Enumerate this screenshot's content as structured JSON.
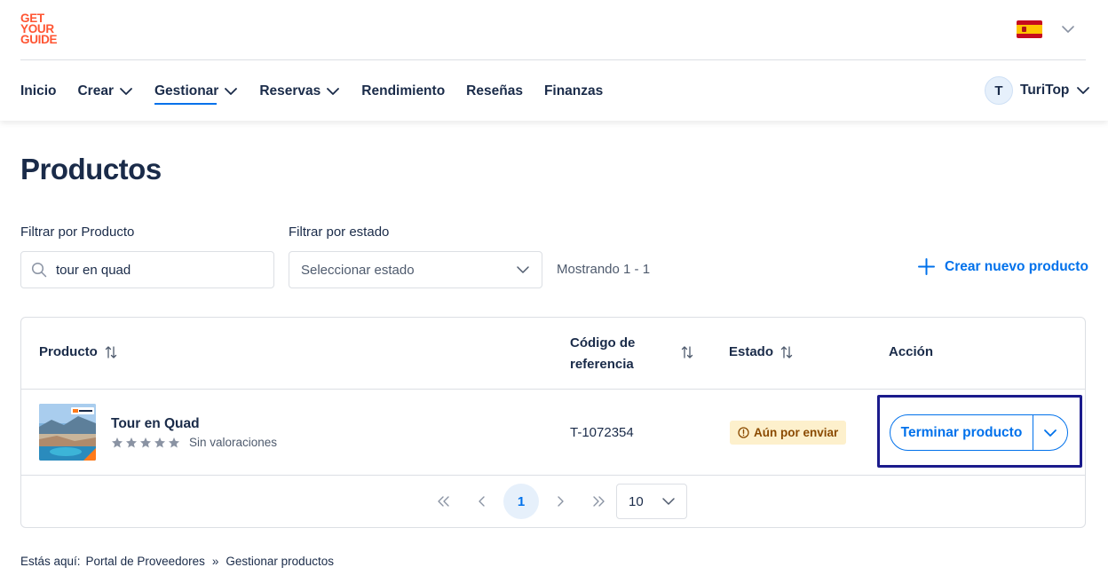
{
  "brand": {
    "logo_lines": [
      "GET",
      "YOUR",
      "GUIDE"
    ],
    "accent": "#ff5533"
  },
  "header": {
    "language_flag": "spain-flag-icon",
    "nav": [
      {
        "label": "Inicio",
        "has_menu": false
      },
      {
        "label": "Crear",
        "has_menu": true
      },
      {
        "label": "Gestionar",
        "has_menu": true,
        "active": true
      },
      {
        "label": "Reservas",
        "has_menu": true
      },
      {
        "label": "Rendimiento",
        "has_menu": false
      },
      {
        "label": "Reseñas",
        "has_menu": false
      },
      {
        "label": "Finanzas",
        "has_menu": false
      }
    ],
    "account": {
      "initial": "T",
      "name": "TuriTop"
    }
  },
  "page": {
    "title": "Productos"
  },
  "filters": {
    "product_label": "Filtrar por Producto",
    "product_value": "tour en quad",
    "status_label": "Filtrar por estado",
    "status_placeholder": "Seleccionar estado",
    "showing": "Mostrando 1 - 1",
    "create_label": "Crear nuevo producto"
  },
  "table": {
    "headers": {
      "product": "Producto",
      "ref_code_line1": "Código de",
      "ref_code_line2": "referencia",
      "status": "Estado",
      "action": "Acción"
    },
    "rows": [
      {
        "name": "Tour en Quad",
        "rating_text": "Sin valoraciones",
        "stars": 0,
        "ref_code": "T-1072354",
        "status": "Aún por enviar",
        "action": "Terminar producto"
      }
    ]
  },
  "pagination": {
    "current_page": "1",
    "page_size": "10"
  },
  "breadcrumb": {
    "lead": "Estás aquí:",
    "items": [
      "Portal de Proveedores",
      "Gestionar productos"
    ],
    "separator": "»"
  },
  "colors": {
    "primary": "#0071eb",
    "text": "#1a2b49",
    "badge_bg": "#fdf0cc",
    "focus_ring": "#1b1b8c"
  }
}
